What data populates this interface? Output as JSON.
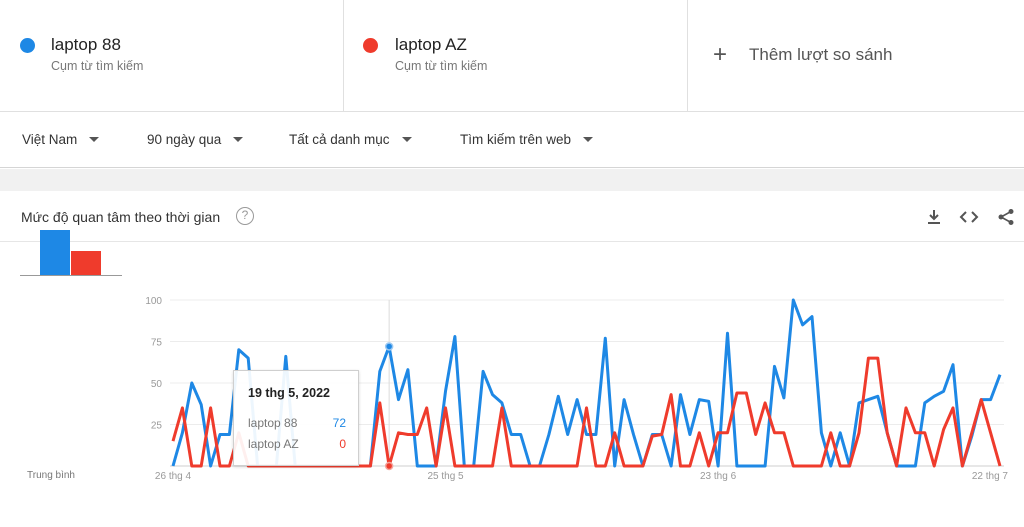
{
  "terms": [
    {
      "name": "laptop 88",
      "subtitle": "Cụm từ tìm kiếm",
      "color": "#1e88e5"
    },
    {
      "name": "laptop AZ",
      "subtitle": "Cụm từ tìm kiếm",
      "color": "#ef3b2c"
    }
  ],
  "add_compare": {
    "label": "Thêm lượt so sánh",
    "icon": "plus-icon"
  },
  "filters": [
    {
      "label": "Việt Nam"
    },
    {
      "label": "90 ngày qua"
    },
    {
      "label": "Tất cả danh mục"
    },
    {
      "label": "Tìm kiếm trên web"
    }
  ],
  "card": {
    "title": "Mức độ quan tâm theo thời gian",
    "help_icon": "?",
    "actions": [
      "download-icon",
      "embed-icon",
      "share-icon"
    ]
  },
  "average": {
    "label": "Trung bình",
    "values": [
      28,
      15
    ]
  },
  "tooltip": {
    "date": "19 thg 5, 2022",
    "rows": [
      {
        "term": "laptop 88",
        "value": "72"
      },
      {
        "term": "laptop AZ",
        "value": "0"
      }
    ]
  },
  "chart_data": {
    "type": "line",
    "ylim": [
      0,
      100
    ],
    "yticks": [
      "25",
      "50",
      "75",
      "100"
    ],
    "xticks": [
      {
        "label": "26 thg 4",
        "index": 0
      },
      {
        "label": "25 thg 5",
        "index": 29
      },
      {
        "label": "23 thg 6",
        "index": 58
      },
      {
        "label": "22 thg 7",
        "index": 87
      }
    ],
    "highlight_index": 23,
    "series": [
      {
        "name": "laptop 88",
        "color": "#1e88e5",
        "values": [
          0,
          20,
          50,
          37,
          0,
          19,
          19,
          70,
          65,
          0,
          0,
          0,
          66,
          0,
          0,
          0,
          0,
          0,
          0,
          0,
          0,
          0,
          57,
          72,
          40,
          58,
          0,
          0,
          0,
          45,
          78,
          0,
          0,
          57,
          43,
          38,
          19,
          19,
          0,
          0,
          19,
          42,
          19,
          40,
          19,
          19,
          77,
          0,
          40,
          19,
          0,
          19,
          19,
          0,
          43,
          19,
          40,
          39,
          0,
          80,
          0,
          0,
          0,
          0,
          60,
          41,
          100,
          85,
          90,
          20,
          0,
          20,
          0,
          38,
          40,
          42,
          20,
          0,
          0,
          0,
          38,
          42,
          45,
          61,
          0,
          18,
          40,
          40,
          55
        ]
      },
      {
        "name": "laptop AZ",
        "color": "#ef3b2c",
        "values": [
          15,
          35,
          0,
          0,
          35,
          0,
          0,
          20,
          0,
          0,
          0,
          0,
          0,
          0,
          0,
          0,
          0,
          0,
          0,
          0,
          0,
          0,
          38,
          0,
          20,
          19,
          19,
          35,
          0,
          35,
          0,
          0,
          0,
          0,
          0,
          35,
          0,
          0,
          0,
          0,
          0,
          0,
          0,
          0,
          35,
          0,
          0,
          20,
          0,
          0,
          0,
          18,
          19,
          43,
          0,
          0,
          20,
          0,
          20,
          20,
          44,
          44,
          19,
          38,
          20,
          20,
          0,
          0,
          0,
          0,
          20,
          0,
          0,
          20,
          65,
          65,
          20,
          0,
          35,
          20,
          20,
          0,
          22,
          35,
          0,
          20,
          40,
          20,
          0
        ]
      }
    ]
  }
}
